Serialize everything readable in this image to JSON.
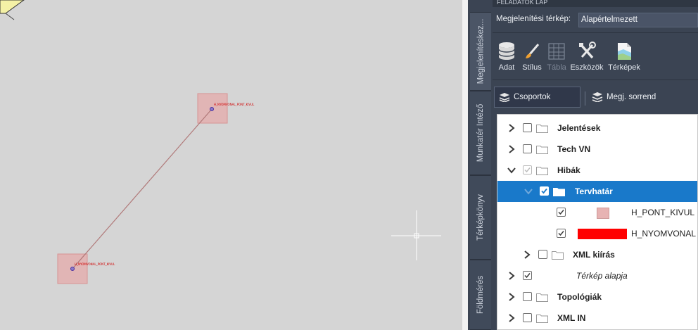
{
  "canvas": {
    "point_labels": [
      "H_NYOMVONAL_PONT_KIVUL",
      "H_NYOMVONAL_PONT_KIVUL"
    ]
  },
  "panel": {
    "header_title": "FELADATOK LAP",
    "vertical_tabs": [
      "Megjelenítéskez...",
      "Munkatér Intéző",
      "Térképkönyv",
      "Földmérés"
    ],
    "map_label": "Megjelenítési térkép:",
    "map_value": "Alapértelmezett",
    "ribbon": [
      {
        "label": "Adat",
        "icon": "database-icon"
      },
      {
        "label": "Stílus",
        "icon": "brush-icon"
      },
      {
        "label": "Tábla",
        "icon": "table-icon",
        "disabled": true
      },
      {
        "label": "Eszközök",
        "icon": "tools-icon"
      },
      {
        "label": "Térképek",
        "icon": "maps-icon"
      }
    ],
    "group_tabs": {
      "groups": "Csoportok",
      "order": "Megj. sorrend"
    },
    "tree": [
      {
        "label": "Jelentések"
      },
      {
        "label": "Tech VN"
      },
      {
        "label": "Hibák"
      },
      {
        "label": "Tervhatár"
      },
      {
        "label": "H_PONT_KIVUL",
        "color": "#e7b3b3"
      },
      {
        "label": "H_NYOMVONAL",
        "color": "#ff0000"
      },
      {
        "label": "XML kiírás"
      },
      {
        "label": "Térkép alapja"
      },
      {
        "label": "Topológiák"
      },
      {
        "label": "XML IN"
      }
    ]
  },
  "colors": {
    "selection": "#1979ca",
    "panel_bg": "#3b4453",
    "canvas_bg": "#d5d5d5"
  }
}
